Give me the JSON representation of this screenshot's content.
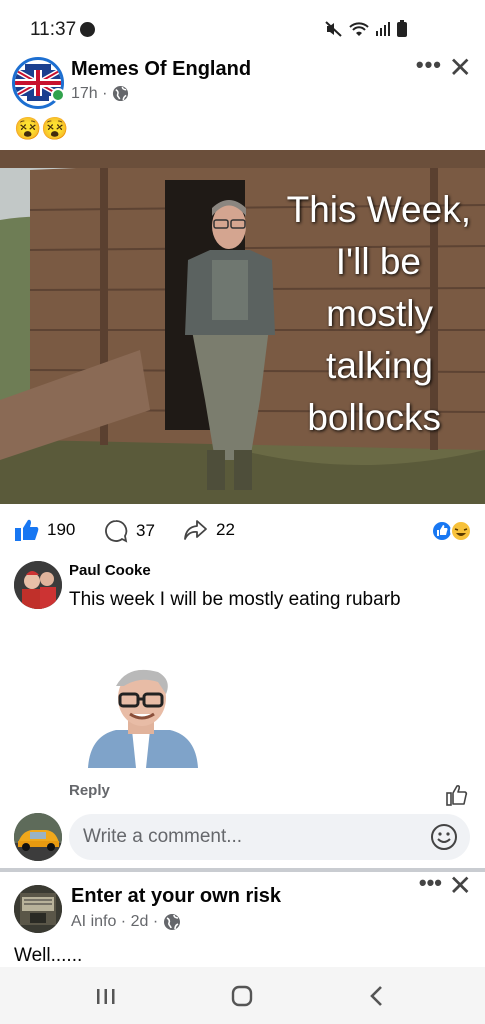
{
  "status_bar": {
    "time": "11:37",
    "icons": [
      "facebook-icon",
      "mute-icon",
      "wifi-icon",
      "signal-icon",
      "battery-icon"
    ]
  },
  "post": {
    "page_name": "Memes Of England",
    "time": "17h ·",
    "text": "😵😵",
    "image_caption": "This Week, I'll be mostly talking bollocks",
    "image_caption_lines": [
      "This Week,",
      "I'll be",
      "mostly",
      "talking",
      "bollocks"
    ],
    "likes": "190",
    "comments": "37",
    "shares": "22"
  },
  "comment": {
    "author": "Paul Cooke",
    "text": "This week I will be mostly eating rubarb",
    "reply_label": "Reply"
  },
  "compose": {
    "placeholder": "Write a comment..."
  },
  "post2": {
    "page_name": "Enter at your own risk",
    "meta": "AI info · 2d ·",
    "text": "Well......"
  },
  "colors": {
    "fb_blue": "#1877f2",
    "text_secondary": "#65676b",
    "input_bg": "#f0f2f5"
  }
}
